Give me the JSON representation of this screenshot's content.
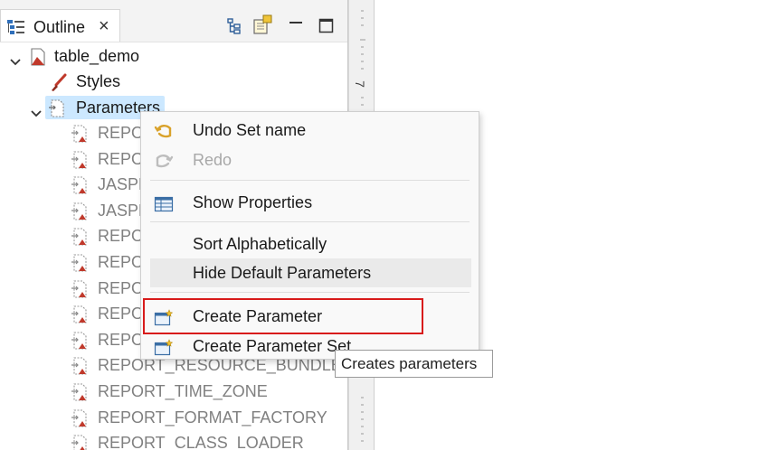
{
  "outline_view": {
    "tab_label": "Outline",
    "tab_icon": "outline-icon",
    "close_glyph": "×",
    "toolbar": [
      "tree-layout-icon",
      "filter-icon",
      "minimize-icon",
      "maximize-icon"
    ]
  },
  "tree": {
    "root_label": "table_demo",
    "styles_label": "Styles",
    "parameters_label": "Parameters",
    "children": [
      {
        "label": "REPORT_CONTEXT"
      },
      {
        "label": "REPORT_PARAMETERS_MAP"
      },
      {
        "label": "JASPER_REPORTS_CONTEXT"
      },
      {
        "label": "JASPER_REPORT"
      },
      {
        "label": "REPORT_CONNECTION"
      },
      {
        "label": "REPORT_MAX_COUNT"
      },
      {
        "label": "REPORT_DATA_SOURCE"
      },
      {
        "label": "REPORT_SCRIPTLET"
      },
      {
        "label": "REPORT_LOCALE"
      },
      {
        "label": "REPORT_RESOURCE_BUNDLE"
      },
      {
        "label": "REPORT_TIME_ZONE"
      },
      {
        "label": "REPORT_FORMAT_FACTORY"
      },
      {
        "label": "REPORT_CLASS_LOADER"
      }
    ]
  },
  "ruler": {
    "mark": "7"
  },
  "context_menu": {
    "undo": "Undo Set name",
    "redo": "Redo",
    "show_properties": "Show Properties",
    "sort_alphabetically": "Sort Alphabetically",
    "hide_default_parameters": "Hide Default Parameters",
    "create_parameter": "Create Parameter",
    "create_parameter_set": "Create Parameter Set"
  },
  "tooltip": {
    "text": "Creates parameters"
  },
  "colors": {
    "selection": "#cce8ff",
    "highlight_box": "#d81b1b",
    "menu_bg": "#f9f9f9"
  }
}
